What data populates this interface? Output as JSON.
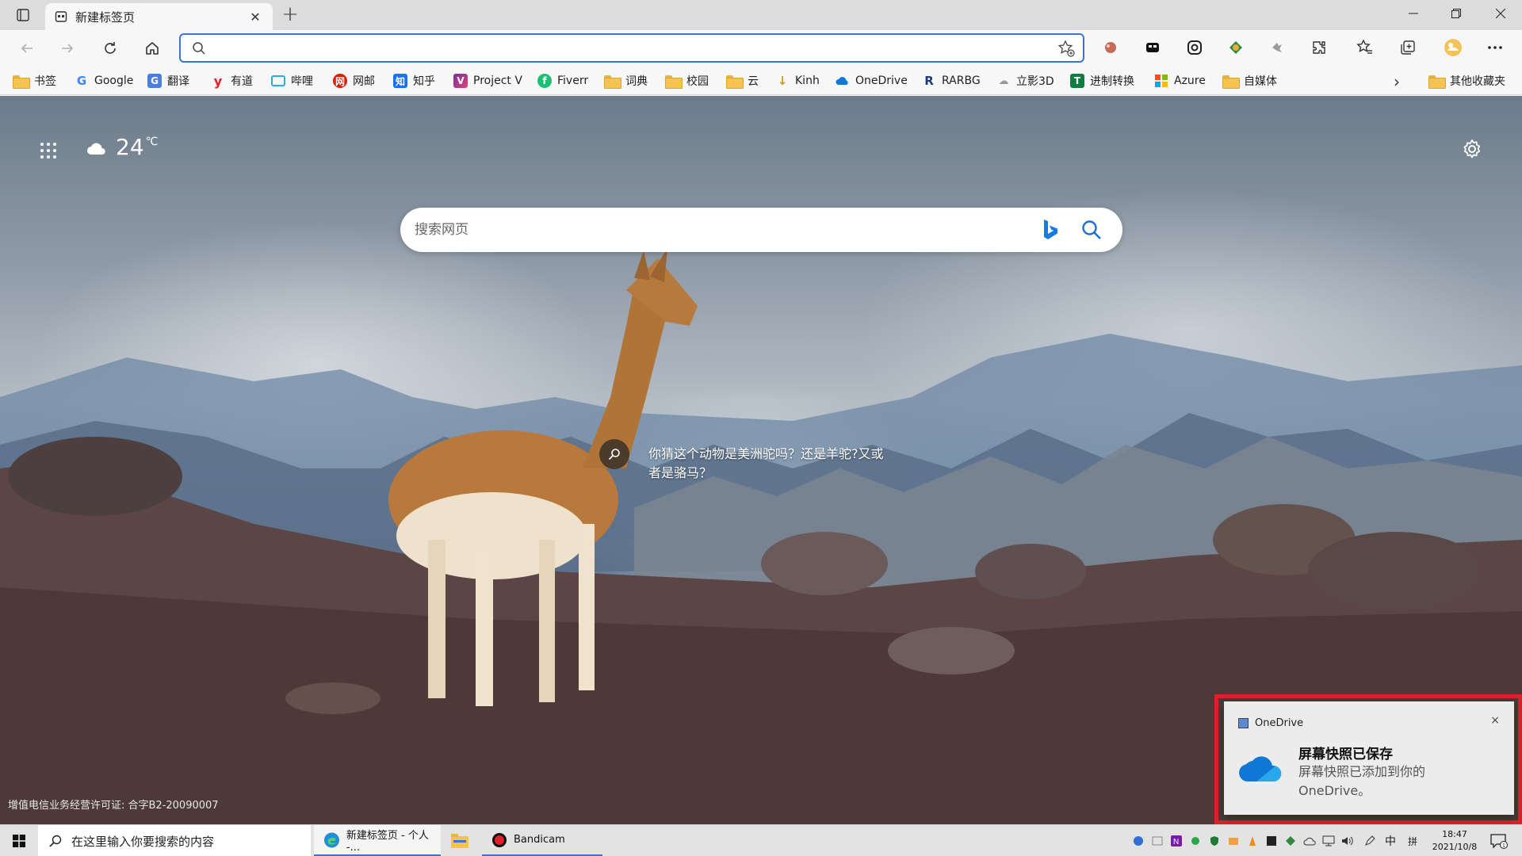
{
  "tab": {
    "title": "新建标签页"
  },
  "address": {
    "value": "",
    "placeholder": ""
  },
  "bookmarks": [
    {
      "label": "书签",
      "icon": "folder-icon"
    },
    {
      "label": "Google",
      "icon": "google-icon"
    },
    {
      "label": "翻译",
      "icon": "translate-icon"
    },
    {
      "label": "有道",
      "icon": "youdao-icon"
    },
    {
      "label": "哔哩",
      "icon": "bilibili-icon"
    },
    {
      "label": "网邮",
      "icon": "netease-mail-icon"
    },
    {
      "label": "知乎",
      "icon": "zhihu-icon"
    },
    {
      "label": "Project V",
      "icon": "project-v-icon"
    },
    {
      "label": "Fiverr",
      "icon": "fiverr-icon"
    },
    {
      "label": "词典",
      "icon": "folder-icon"
    },
    {
      "label": "校园",
      "icon": "folder-icon"
    },
    {
      "label": "云",
      "icon": "folder-icon"
    },
    {
      "label": "Kinh",
      "icon": "kinh-icon"
    },
    {
      "label": "OneDrive",
      "icon": "onedrive-icon"
    },
    {
      "label": "RARBG",
      "icon": "rarbg-icon"
    },
    {
      "label": "立影3D",
      "icon": "liying-icon"
    },
    {
      "label": "进制转换",
      "icon": "converter-icon"
    },
    {
      "label": "Azure",
      "icon": "microsoft-icon"
    },
    {
      "label": "自媒体",
      "icon": "folder-icon"
    }
  ],
  "other_bookmarks": "其他收藏夹",
  "page": {
    "weather_temp": "24",
    "weather_unit": "℃",
    "search_placeholder": "搜索网页",
    "caption": "你猜这个动物是美洲驼吗？还是羊驼?又或者是骆马？",
    "license": "增值电信业务经营许可证: 合字B2-20090007"
  },
  "toast": {
    "app": "OneDrive",
    "close": "×",
    "title": "屏幕快照已保存",
    "body": "屏幕快照已添加到你的 OneDrive。"
  },
  "taskbar": {
    "search_text": "在这里输入你要搜索的内容",
    "apps": [
      {
        "label": "新建标签页 - 个人 -...",
        "icon": "edge-icon"
      },
      {
        "label": "",
        "icon": "file-explorer-icon"
      },
      {
        "label": "Bandicam",
        "icon": "bandicam-icon"
      }
    ],
    "ime": "中",
    "ime_mode": "拼",
    "time": "18:47",
    "date": "2021/10/8",
    "notifications": "1"
  },
  "colors": {
    "accent": "#3a74d4",
    "toast_border": "#e0202a"
  }
}
